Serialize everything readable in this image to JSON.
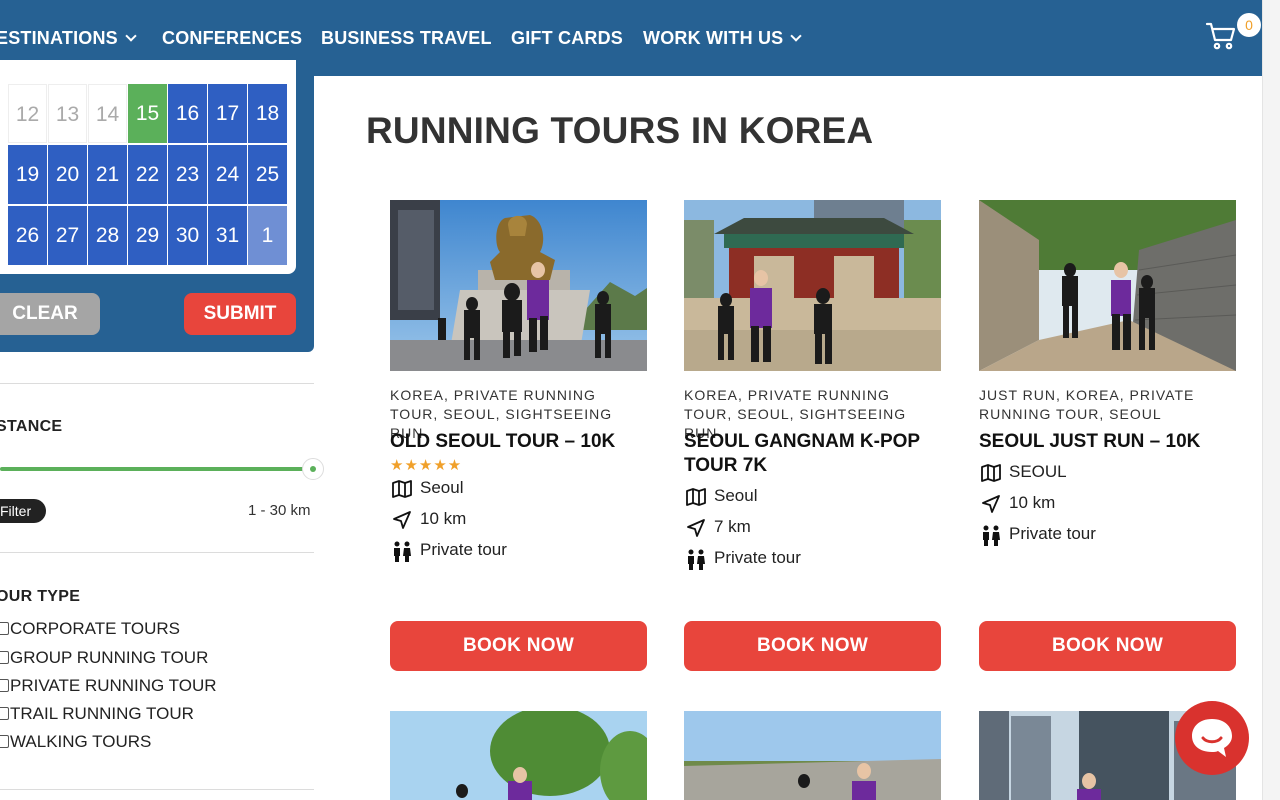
{
  "nav": {
    "items": [
      {
        "label": "ESTINATIONS",
        "dropdown": true
      },
      {
        "label": "CONFERENCES",
        "dropdown": false
      },
      {
        "label": "BUSINESS TRAVEL",
        "dropdown": false
      },
      {
        "label": "GIFT CARDS",
        "dropdown": false
      },
      {
        "label": "WORK WITH US",
        "dropdown": true
      }
    ],
    "cart_count": "0",
    "colors": {
      "bar": "#266193"
    }
  },
  "calendar": {
    "rows": [
      [
        {
          "d": "12",
          "s": "past"
        },
        {
          "d": "13",
          "s": "past"
        },
        {
          "d": "14",
          "s": "past"
        },
        {
          "d": "15",
          "s": "today"
        },
        {
          "d": "16",
          "s": "avail"
        },
        {
          "d": "17",
          "s": "avail"
        },
        {
          "d": "18",
          "s": "avail"
        }
      ],
      [
        {
          "d": "19",
          "s": "avail"
        },
        {
          "d": "20",
          "s": "avail"
        },
        {
          "d": "21",
          "s": "avail"
        },
        {
          "d": "22",
          "s": "avail"
        },
        {
          "d": "23",
          "s": "avail"
        },
        {
          "d": "24",
          "s": "avail"
        },
        {
          "d": "25",
          "s": "avail"
        }
      ],
      [
        {
          "d": "26",
          "s": "avail"
        },
        {
          "d": "27",
          "s": "avail"
        },
        {
          "d": "28",
          "s": "avail"
        },
        {
          "d": "29",
          "s": "avail"
        },
        {
          "d": "30",
          "s": "avail"
        },
        {
          "d": "31",
          "s": "avail"
        },
        {
          "d": "1",
          "s": "next"
        }
      ]
    ],
    "clear_label": "CLEAR",
    "submit_label": "SUBMIT"
  },
  "filters": {
    "distance_label": "STANCE",
    "distance_max_fraction": 1.0,
    "filter_label": "Filter",
    "range_text": "1 - 30 km",
    "tour_type_label": "OUR TYPE",
    "tour_types": [
      "CORPORATE TOURS",
      "GROUP RUNNING TOUR",
      "PRIVATE RUNNING TOUR",
      "TRAIL RUNNING TOUR",
      "WALKING TOURS"
    ]
  },
  "main": {
    "title": "RUNNING TOURS IN KOREA",
    "book_label": "BOOK NOW",
    "cards": [
      {
        "cats": "KOREA, PRIVATE RUNNING TOUR, SEOUL, SIGHTSEEING RUN",
        "title": "OLD SEOUL TOUR – 10K",
        "stars": "★★★★★",
        "location": "Seoul",
        "distance": "10 km",
        "type": "Private tour",
        "image": "statue-runners-photo"
      },
      {
        "cats": "KOREA, PRIVATE RUNNING TOUR, SEOUL, SIGHTSEEING RUN",
        "title": "SEOUL GANGNAM K-POP TOUR 7K",
        "stars": "",
        "location": "Seoul",
        "distance": "7 km",
        "type": "Private tour",
        "image": "temple-gate-runners-photo"
      },
      {
        "cats": "JUST RUN, KOREA, PRIVATE RUNNING TOUR, SEOUL",
        "title": "SEOUL JUST RUN – 10K",
        "stars": "",
        "location": "SEOUL",
        "distance": "10 km",
        "type": "Private tour",
        "image": "stone-wall-path-runners-photo"
      }
    ]
  },
  "colors": {
    "accent_red": "#e8453c",
    "calendar_blue": "#2f5fc2",
    "today_green": "#5bb05a",
    "star": "#f0a02a"
  }
}
